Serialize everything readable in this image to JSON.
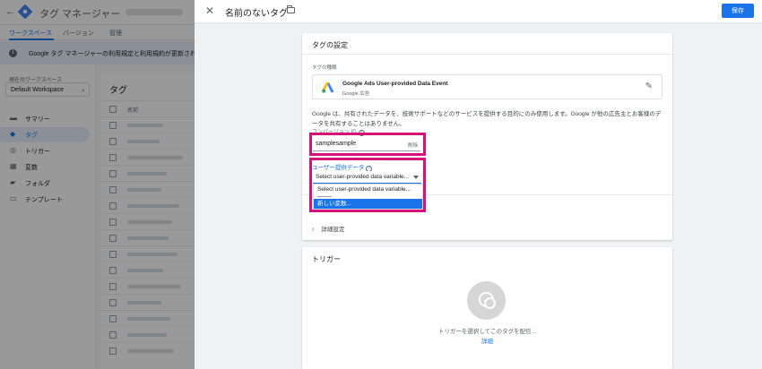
{
  "app": {
    "title": "タグ マネージャー",
    "tabs": [
      {
        "label": "ワークスペース"
      },
      {
        "label": "バージョン"
      },
      {
        "label": "管理"
      }
    ],
    "banner": "Google タグ マネージャーの利用規定と利用規約が更新されまし",
    "workspace": {
      "label": "現在のワークスペース",
      "name": "Default Workspace"
    },
    "nav": [
      {
        "label": "サマリー"
      },
      {
        "label": "タグ"
      },
      {
        "label": "トリガー"
      },
      {
        "label": "変数"
      },
      {
        "label": "フォルダ"
      },
      {
        "label": "テンプレート"
      }
    ],
    "list": {
      "title": "タグ",
      "col_name": "名前"
    }
  },
  "panel": {
    "title": "名前のないタグ",
    "save_label": "保存",
    "config": {
      "title": "タグの設定",
      "tag_type_label": "タグの種類",
      "tag_type_name": "Google Ads User-provided Data Event",
      "tag_type_sub": "Google 広告",
      "description": "Google は、共有されたデータを、技術サポートなどのサービスを提供する目的にのみ使用します。Google が他の広告主とお客様のデータを共有することはありません。",
      "conversion_label": "コンバージョン ID",
      "conversion_value": "samplesample",
      "conversion_suffix": "削除",
      "userdata_label": "ユーザー提供データ",
      "userdata_selected": "Select user-provided data variable...",
      "dropdown_options": [
        "Select user-provided data variable...",
        "新しい変数..."
      ],
      "advanced_label": "詳細設定"
    },
    "trigger": {
      "title": "トリガー",
      "hint": "トリガーを選択してこのタグを配信...",
      "link": "詳細"
    }
  },
  "colors": {
    "accent": "#1a73e8",
    "highlight": "#d6127a"
  }
}
